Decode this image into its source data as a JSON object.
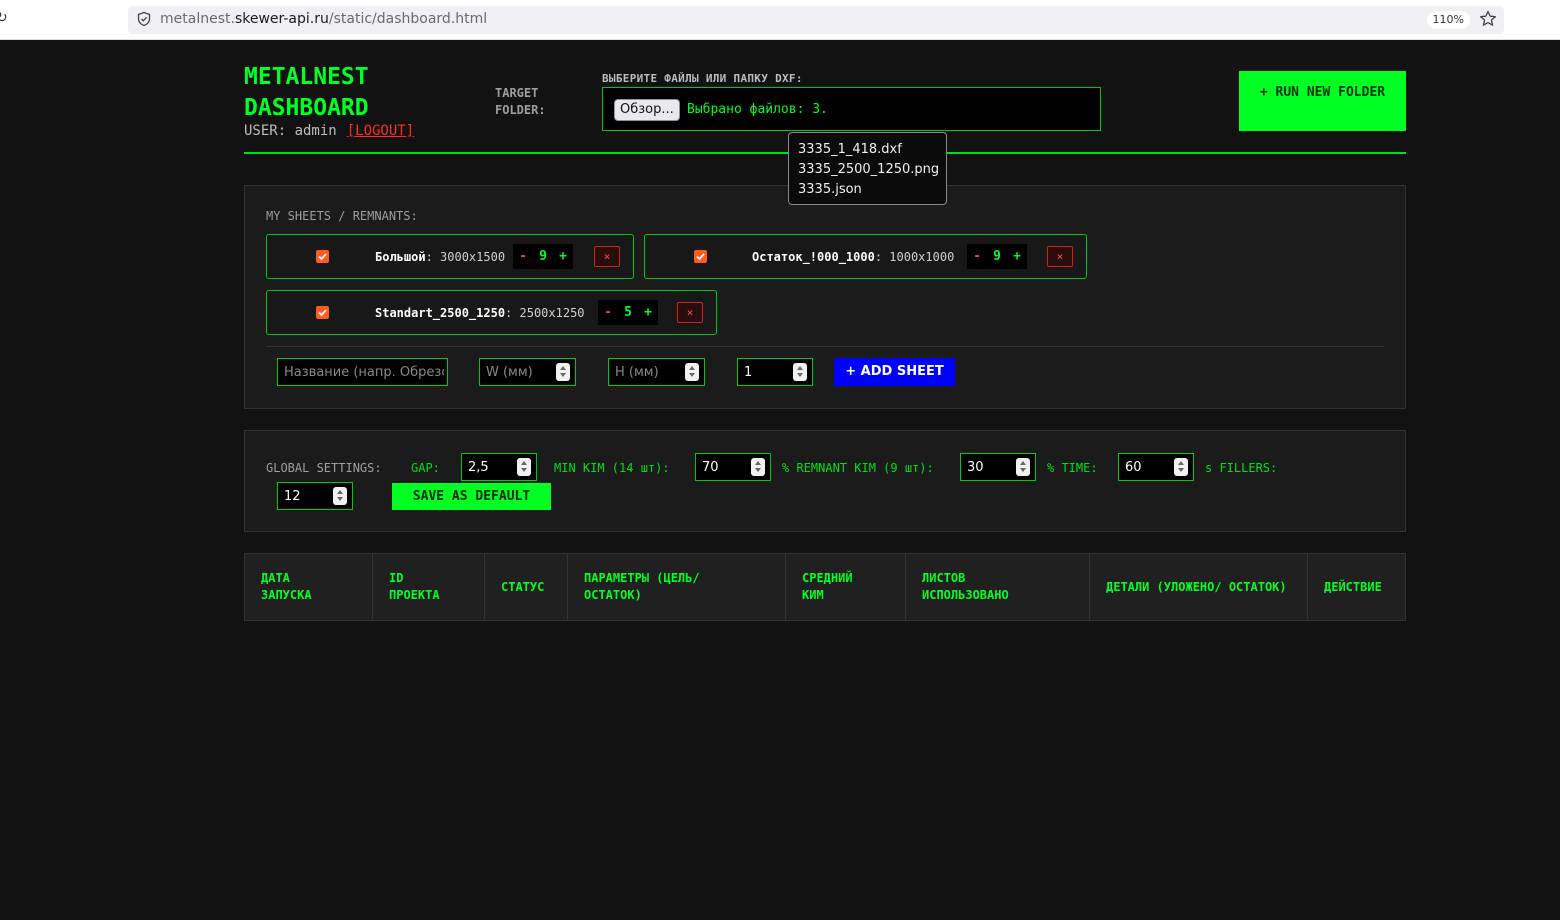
{
  "browser": {
    "url_prefix": "metalnest.",
    "url_domain": "skewer-api.ru",
    "url_path": "/static/dashboard.html",
    "zoom": "110%"
  },
  "header": {
    "title": "METALNEST DASHBOARD",
    "user_label": "USER: admin",
    "logout_label": "[LOGOUT]",
    "target_folder_label": "TARGET FOLDER:",
    "choose_label": "ВЫБЕРИТЕ ФАЙЛЫ ИЛИ ПАПКУ DXF:",
    "browse_label": "Обзор...",
    "file_count": "Выбрано файлов: 3.",
    "run_label": "+ RUN NEW FOLDER"
  },
  "tooltip": {
    "files": [
      "3335_1_418.dxf",
      "3335_2500_1250.png",
      "3335.json"
    ]
  },
  "sheets": {
    "label": "MY SHEETS / REMNANTS:",
    "items": [
      {
        "name": "Большой",
        "dims": ": 3000x1500",
        "qty": "9",
        "checked": true
      },
      {
        "name": "Остаток_!000_1000",
        "dims": ": 1000x1000",
        "qty": "9",
        "checked": true
      },
      {
        "name": "Standart_2500_1250",
        "dims": ": 2500x1250",
        "qty": "5",
        "checked": true
      }
    ],
    "minus": "-",
    "plus": "+",
    "delete": "×",
    "name_placeholder": "Название (напр. Обрезо",
    "w_placeholder": "W (мм)",
    "h_placeholder": "H (мм)",
    "count_value": "1",
    "add_label": "+ ADD SHEET"
  },
  "settings": {
    "label": "GLOBAL SETTINGS:",
    "gap_label": "GAP:",
    "gap_value": "2,5",
    "min_kim_label": "MIN KIM (14 шт):",
    "min_kim_value": "70",
    "remnant_label": "% REMNANT KIM (9 шт):",
    "remnant_value": "30",
    "time_label": "% TIME:",
    "time_value": "60",
    "fillers_label": "s FILLERS:",
    "fillers_value": "12",
    "save_label": "SAVE AS DEFAULT"
  },
  "table": {
    "headers": [
      "ДАТА ЗАПУСКА",
      "ID ПРОЕКТА",
      "СТАТУС",
      "ПАРАМЕТРЫ (ЦЕЛЬ/ ОСТАТОК)",
      "СРЕДНИЙ КИМ",
      "ЛИСТОВ ИСПОЛЬЗОВАНО",
      "ДЕТАЛИ (УЛОЖЕНО/ ОСТАТОК)",
      "ДЕЙСТВИЕ"
    ]
  },
  "colors": {
    "accent": "#00ff22",
    "danger": "#ff3b3b",
    "add_button": "#0000ff",
    "checkbox": "#ff5a1f"
  }
}
